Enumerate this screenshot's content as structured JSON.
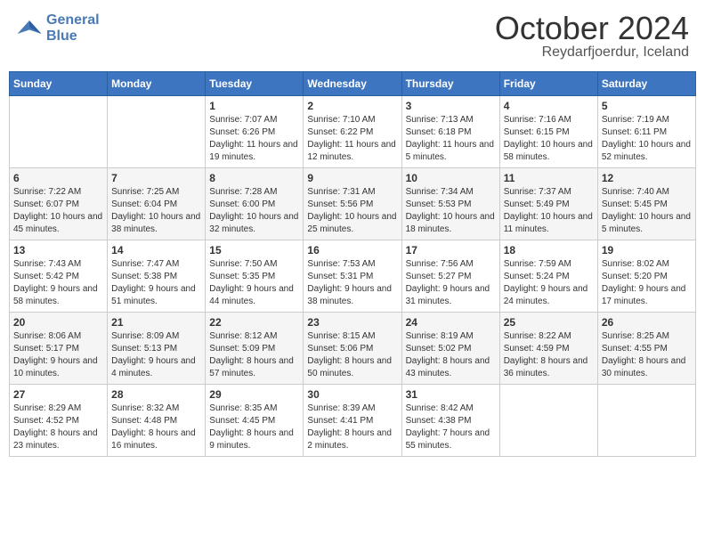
{
  "logo": {
    "line1": "General",
    "line2": "Blue"
  },
  "title": "October 2024",
  "location": "Reydarfjoerdur, Iceland",
  "days_of_week": [
    "Sunday",
    "Monday",
    "Tuesday",
    "Wednesday",
    "Thursday",
    "Friday",
    "Saturday"
  ],
  "weeks": [
    [
      {
        "day": "",
        "info": ""
      },
      {
        "day": "",
        "info": ""
      },
      {
        "day": "1",
        "info": "Sunrise: 7:07 AM\nSunset: 6:26 PM\nDaylight: 11 hours\nand 19 minutes."
      },
      {
        "day": "2",
        "info": "Sunrise: 7:10 AM\nSunset: 6:22 PM\nDaylight: 11 hours\nand 12 minutes."
      },
      {
        "day": "3",
        "info": "Sunrise: 7:13 AM\nSunset: 6:18 PM\nDaylight: 11 hours\nand 5 minutes."
      },
      {
        "day": "4",
        "info": "Sunrise: 7:16 AM\nSunset: 6:15 PM\nDaylight: 10 hours\nand 58 minutes."
      },
      {
        "day": "5",
        "info": "Sunrise: 7:19 AM\nSunset: 6:11 PM\nDaylight: 10 hours\nand 52 minutes."
      }
    ],
    [
      {
        "day": "6",
        "info": "Sunrise: 7:22 AM\nSunset: 6:07 PM\nDaylight: 10 hours\nand 45 minutes."
      },
      {
        "day": "7",
        "info": "Sunrise: 7:25 AM\nSunset: 6:04 PM\nDaylight: 10 hours\nand 38 minutes."
      },
      {
        "day": "8",
        "info": "Sunrise: 7:28 AM\nSunset: 6:00 PM\nDaylight: 10 hours\nand 32 minutes."
      },
      {
        "day": "9",
        "info": "Sunrise: 7:31 AM\nSunset: 5:56 PM\nDaylight: 10 hours\nand 25 minutes."
      },
      {
        "day": "10",
        "info": "Sunrise: 7:34 AM\nSunset: 5:53 PM\nDaylight: 10 hours\nand 18 minutes."
      },
      {
        "day": "11",
        "info": "Sunrise: 7:37 AM\nSunset: 5:49 PM\nDaylight: 10 hours\nand 11 minutes."
      },
      {
        "day": "12",
        "info": "Sunrise: 7:40 AM\nSunset: 5:45 PM\nDaylight: 10 hours\nand 5 minutes."
      }
    ],
    [
      {
        "day": "13",
        "info": "Sunrise: 7:43 AM\nSunset: 5:42 PM\nDaylight: 9 hours\nand 58 minutes."
      },
      {
        "day": "14",
        "info": "Sunrise: 7:47 AM\nSunset: 5:38 PM\nDaylight: 9 hours\nand 51 minutes."
      },
      {
        "day": "15",
        "info": "Sunrise: 7:50 AM\nSunset: 5:35 PM\nDaylight: 9 hours\nand 44 minutes."
      },
      {
        "day": "16",
        "info": "Sunrise: 7:53 AM\nSunset: 5:31 PM\nDaylight: 9 hours\nand 38 minutes."
      },
      {
        "day": "17",
        "info": "Sunrise: 7:56 AM\nSunset: 5:27 PM\nDaylight: 9 hours\nand 31 minutes."
      },
      {
        "day": "18",
        "info": "Sunrise: 7:59 AM\nSunset: 5:24 PM\nDaylight: 9 hours\nand 24 minutes."
      },
      {
        "day": "19",
        "info": "Sunrise: 8:02 AM\nSunset: 5:20 PM\nDaylight: 9 hours\nand 17 minutes."
      }
    ],
    [
      {
        "day": "20",
        "info": "Sunrise: 8:06 AM\nSunset: 5:17 PM\nDaylight: 9 hours\nand 10 minutes."
      },
      {
        "day": "21",
        "info": "Sunrise: 8:09 AM\nSunset: 5:13 PM\nDaylight: 9 hours\nand 4 minutes."
      },
      {
        "day": "22",
        "info": "Sunrise: 8:12 AM\nSunset: 5:09 PM\nDaylight: 8 hours\nand 57 minutes."
      },
      {
        "day": "23",
        "info": "Sunrise: 8:15 AM\nSunset: 5:06 PM\nDaylight: 8 hours\nand 50 minutes."
      },
      {
        "day": "24",
        "info": "Sunrise: 8:19 AM\nSunset: 5:02 PM\nDaylight: 8 hours\nand 43 minutes."
      },
      {
        "day": "25",
        "info": "Sunrise: 8:22 AM\nSunset: 4:59 PM\nDaylight: 8 hours\nand 36 minutes."
      },
      {
        "day": "26",
        "info": "Sunrise: 8:25 AM\nSunset: 4:55 PM\nDaylight: 8 hours\nand 30 minutes."
      }
    ],
    [
      {
        "day": "27",
        "info": "Sunrise: 8:29 AM\nSunset: 4:52 PM\nDaylight: 8 hours\nand 23 minutes."
      },
      {
        "day": "28",
        "info": "Sunrise: 8:32 AM\nSunset: 4:48 PM\nDaylight: 8 hours\nand 16 minutes."
      },
      {
        "day": "29",
        "info": "Sunrise: 8:35 AM\nSunset: 4:45 PM\nDaylight: 8 hours\nand 9 minutes."
      },
      {
        "day": "30",
        "info": "Sunrise: 8:39 AM\nSunset: 4:41 PM\nDaylight: 8 hours\nand 2 minutes."
      },
      {
        "day": "31",
        "info": "Sunrise: 8:42 AM\nSunset: 4:38 PM\nDaylight: 7 hours\nand 55 minutes."
      },
      {
        "day": "",
        "info": ""
      },
      {
        "day": "",
        "info": ""
      }
    ]
  ]
}
